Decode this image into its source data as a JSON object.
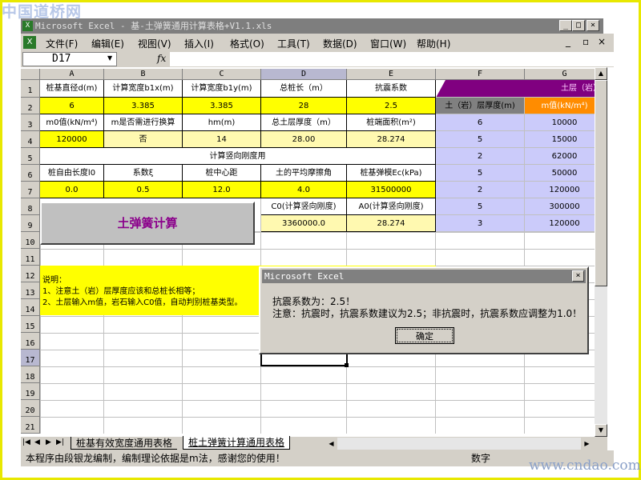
{
  "watermark_top": "中国道桥网",
  "watermark_bottom": "www.cndao.com",
  "window": {
    "title": "Microsoft Excel - 基-土弹簧通用计算表格+V1.1.xls",
    "min": "_",
    "max": "□",
    "close": "×"
  },
  "menu": [
    "文件(F)",
    "编辑(E)",
    "视图(V)",
    "插入(I)",
    "格式(O)",
    "工具(T)",
    "数据(D)",
    "窗口(W)",
    "帮助(H)"
  ],
  "mdi_controls": [
    "_",
    "▫",
    "×"
  ],
  "formula": {
    "cell_ref": "D17",
    "fx": "fx",
    "value": ""
  },
  "columns": [
    "A",
    "B",
    "C",
    "D",
    "E",
    "F",
    "G"
  ],
  "rows": [
    "1",
    "2",
    "3",
    "4",
    "5",
    "6",
    "7",
    "8",
    "9",
    "10",
    "11",
    "12",
    "13",
    "14",
    "15",
    "16",
    "17",
    "18",
    "19",
    "20",
    "21"
  ],
  "cells": {
    "r1": [
      "桩基直径d(m)",
      "计算宽度b1x(m)",
      "计算宽度b1y(m)",
      "总桩长（m）",
      "抗震系数"
    ],
    "r2": [
      "6",
      "3.385",
      "3.385",
      "28",
      "2.5"
    ],
    "r3": [
      "m0值(kN/m⁴)",
      "m是否需进行换算",
      "hm(m)",
      "总土层厚度（m）",
      "桩端面积(m²)"
    ],
    "r4": [
      "120000",
      "否",
      "14",
      "28.00",
      "28.274"
    ],
    "r5": "计算竖向刚度用",
    "r6": [
      "桩自由长度l0",
      "系数ξ",
      "桩中心距",
      "土的平均摩擦角",
      "桩基弹模Ec(kPa)"
    ],
    "r7": [
      "0.0",
      "0.5",
      "12.0",
      "4.0",
      "31500000"
    ],
    "r8": [
      "C0(计算竖向刚度)",
      "A0(计算竖向刚度)"
    ],
    "r9": [
      "3360000.0",
      "28.274"
    ]
  },
  "soil_table": {
    "header": "土层（岩）",
    "col1": "土（岩）层厚度(m)",
    "col2": "m值(kN/m⁴)",
    "thickness": [
      "6",
      "5",
      "2",
      "5",
      "2",
      "5",
      "3"
    ],
    "m_values": [
      "10000",
      "15000",
      "62000",
      "50000",
      "120000",
      "300000",
      "120000"
    ]
  },
  "calc_button": "土弹簧计算",
  "notes": [
    "说明：",
    "1、注意土（岩）层厚度应该和总桩长相等；",
    "2、土层输入m值，岩石输入C0值，自动判别桩基类型。"
  ],
  "sheet_tabs": [
    "桩基有效宽度通用表格",
    "桩土弹簧计算通用表格"
  ],
  "status": {
    "text": "本程序由段银龙编制，编制理论依据是m法，感谢您的使用！",
    "mode": "数字"
  },
  "dialog": {
    "title": "Microsoft Excel",
    "line1": "抗震系数为：2.5！",
    "line2": "注意：抗震时，抗震系数建议为2.5；非抗震时，抗震系数应调整为1.0！",
    "ok": "确定"
  },
  "colors": {
    "yellow": "#ffff00",
    "lavender": "#cbcbfa",
    "purple": "#800080",
    "orange": "#ff8c00"
  }
}
